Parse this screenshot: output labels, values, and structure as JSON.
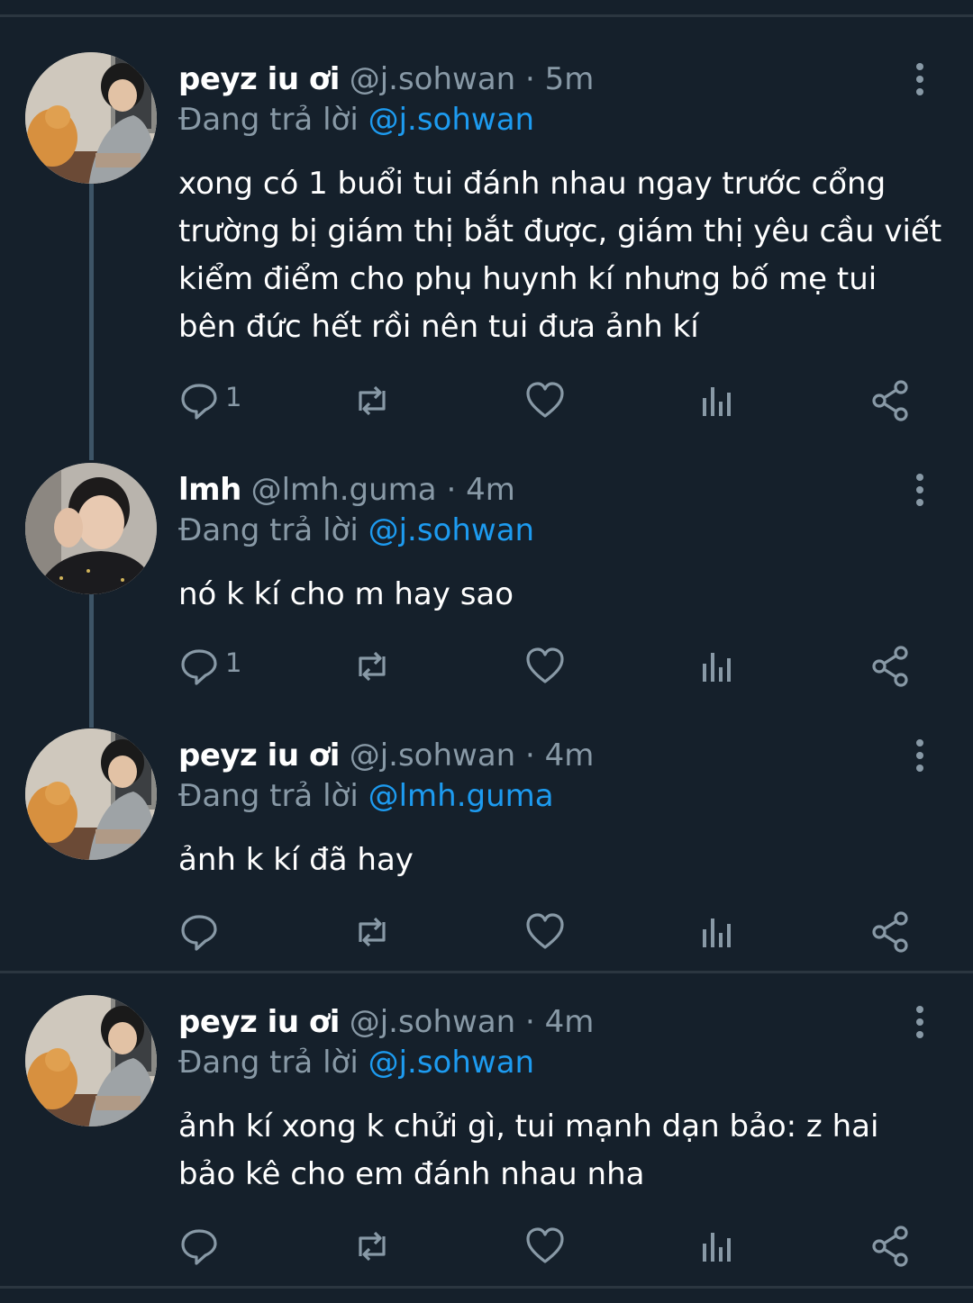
{
  "tweets": [
    {
      "name": "peyz iu ơi",
      "handle": "@j.sohwan",
      "time": "5m",
      "replying_prefix": "Đang trả lời",
      "replying_to": "@j.sohwan",
      "text": "xong có 1 buổi tui đánh nhau ngay trước cổng trường bị giám thị bắt được, giám thị yêu cầu viết kiểm điểm cho phụ huynh kí nhưng bố mẹ tui bên đức hết rồi nên tui đưa ảnh kí",
      "reply_count": "1"
    },
    {
      "name": "lmh",
      "handle": "@lmh.guma",
      "time": "4m",
      "replying_prefix": "Đang trả lời",
      "replying_to": "@j.sohwan",
      "text": "nó k kí cho m hay sao",
      "reply_count": "1"
    },
    {
      "name": "peyz iu ơi",
      "handle": "@j.sohwan",
      "time": "4m",
      "replying_prefix": "Đang trả lời",
      "replying_to": "@lmh.guma",
      "text": "ảnh k kí đã hay",
      "reply_count": ""
    },
    {
      "name": "peyz iu ơi",
      "handle": "@j.sohwan",
      "time": "4m",
      "replying_prefix": "Đang trả lời",
      "replying_to": "@j.sohwan",
      "text": "ảnh kí xong k chửi gì, tui mạnh dạn bảo: z hai bảo kê cho em đánh nhau nha",
      "reply_count": ""
    }
  ],
  "separator": "·",
  "icons": {
    "reply": "reply-icon",
    "retweet": "retweet-icon",
    "like": "heart-icon",
    "analytics": "analytics-icon",
    "share": "share-icon",
    "more": "more-vertical-icon"
  },
  "colors": {
    "background": "#15202b",
    "secondary_text": "#8899a6",
    "mention": "#1d9bf0",
    "thread_line": "#3d5466"
  }
}
